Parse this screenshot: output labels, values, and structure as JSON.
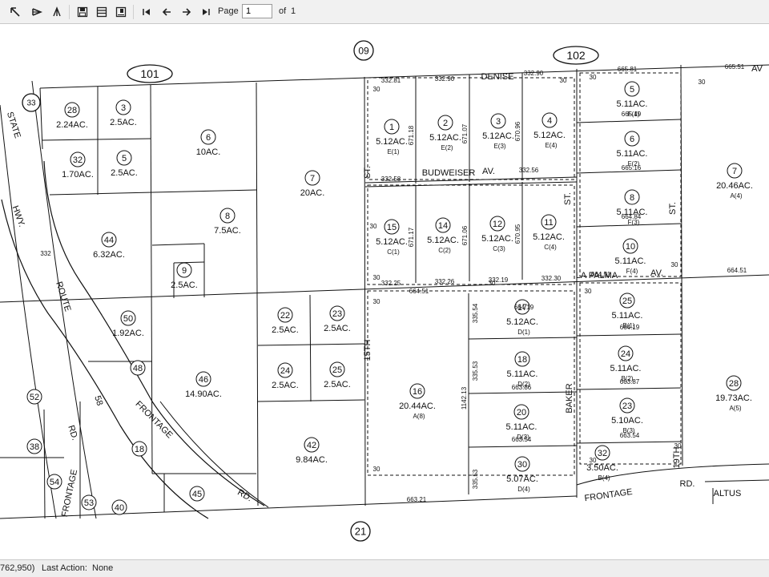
{
  "toolbar": {
    "page_label": "Page",
    "page_value": "1",
    "of_label": "of",
    "page_total": "1",
    "icons": [
      "print-icon",
      "export-icon",
      "tree-icon",
      "save-icon",
      "layout-icon",
      "save-as-icon",
      "first-page-icon",
      "prev-page-icon",
      "next-page-icon",
      "last-page-icon"
    ]
  },
  "map": {
    "road_circles": [
      "09",
      "101",
      "102",
      "21",
      "33"
    ],
    "roads": [
      {
        "text": "STATE"
      },
      {
        "text": "HWY."
      },
      {
        "text": "ROUTE"
      },
      {
        "text": "58"
      },
      {
        "text": "FRONTAGE"
      },
      {
        "text": "RD."
      },
      {
        "text": "FRONTAGE"
      },
      {
        "text": "RD."
      },
      {
        "text": "FRONTAGE"
      },
      {
        "text": "RD."
      },
      {
        "text": "DENISE"
      },
      {
        "text": "BUDWEISER"
      },
      {
        "text": "AV."
      },
      {
        "text": "15TH"
      },
      {
        "text": "ST."
      },
      {
        "text": "LA PALMA"
      },
      {
        "text": "AV."
      },
      {
        "text": "BAKER"
      },
      {
        "text": "19TH"
      },
      {
        "text": "ST."
      },
      {
        "text": "ALTUS"
      },
      {
        "text": "AV"
      },
      {
        "text": "ST."
      }
    ],
    "parcels": [
      {
        "num": "28",
        "area": "2.24AC."
      },
      {
        "num": "3",
        "area": "2.5AC."
      },
      {
        "num": "32",
        "area": "1.70AC."
      },
      {
        "num": "5",
        "area": "2.5AC."
      },
      {
        "num": "6",
        "area": "10AC."
      },
      {
        "num": "7",
        "area": "20AC."
      },
      {
        "num": "44",
        "area": "6.32AC."
      },
      {
        "num": "8",
        "area": "7.5AC."
      },
      {
        "num": "9",
        "area": "2.5AC."
      },
      {
        "num": "50",
        "area": "1.92AC."
      },
      {
        "num": "48",
        "area": ""
      },
      {
        "num": "46",
        "area": "14.90AC."
      },
      {
        "num": "22",
        "area": "2.5AC."
      },
      {
        "num": "23",
        "area": "2.5AC."
      },
      {
        "num": "24",
        "area": "2.5AC."
      },
      {
        "num": "25",
        "area": "2.5AC."
      },
      {
        "num": "42",
        "area": "9.84AC."
      },
      {
        "num": "52",
        "area": ""
      },
      {
        "num": "38",
        "area": ""
      },
      {
        "num": "18",
        "area": ""
      },
      {
        "num": "54",
        "area": ""
      },
      {
        "num": "53",
        "area": ""
      },
      {
        "num": "40",
        "area": ""
      },
      {
        "num": "45",
        "area": ""
      },
      {
        "num": "1",
        "area": "5.12AC.",
        "sub": "E(1)"
      },
      {
        "num": "2",
        "area": "5.12AC.",
        "sub": "E(2)"
      },
      {
        "num": "3",
        "area": "5.12AC.",
        "sub": "E(3)"
      },
      {
        "num": "4",
        "area": "5.12AC.",
        "sub": "E(4)"
      },
      {
        "num": "15",
        "area": "5.12AC.",
        "sub": "C(1)"
      },
      {
        "num": "14",
        "area": "5.12AC.",
        "sub": "C(2)"
      },
      {
        "num": "12",
        "area": "5.12AC.",
        "sub": "C(3)"
      },
      {
        "num": "11",
        "area": "5.12AC.",
        "sub": "C(4)"
      },
      {
        "num": "5",
        "area": "5.11AC.",
        "sub": "F(1)"
      },
      {
        "num": "6",
        "area": "5.11AC.",
        "sub": "F(2)"
      },
      {
        "num": "8",
        "area": "5.11AC.",
        "sub": "F(3)"
      },
      {
        "num": "10",
        "area": "5.11AC.",
        "sub": "F(4)"
      },
      {
        "num": "7",
        "area": "20.46AC.",
        "sub": "A(4)"
      },
      {
        "num": "16",
        "area": "20.44AC.",
        "sub": "A(8)"
      },
      {
        "num": "17",
        "area": "5.12AC.",
        "sub": "D(1)"
      },
      {
        "num": "18",
        "area": "5.11AC.",
        "sub": "D(2)"
      },
      {
        "num": "20",
        "area": "5.11AC.",
        "sub": "D(3)"
      },
      {
        "num": "30",
        "area": "5.07AC.",
        "sub": "D(4)"
      },
      {
        "num": "25",
        "area": "5.11AC.",
        "sub": "B(1)"
      },
      {
        "num": "24",
        "area": "5.11AC.",
        "sub": "B(2)"
      },
      {
        "num": "23",
        "area": "5.10AC.",
        "sub": "B(3)"
      },
      {
        "num": "32",
        "area": "3.50AC.",
        "sub": "B(4)"
      },
      {
        "num": "28",
        "area": "19.73AC.",
        "sub": "A(5)"
      }
    ],
    "dims": [
      "665.81",
      "665.51",
      "665.49",
      "665.16",
      "664.84",
      "664.51",
      "664.51",
      "664.51",
      "664.19",
      "664.19",
      "663.87",
      "663.86",
      "663.54",
      "663.54",
      "663.21",
      "332.81",
      "332.90",
      "332.90",
      "332.58",
      "332.56",
      "332.25",
      "332.26",
      "332.19",
      "332.30",
      "671.18",
      "671.07",
      "670.96",
      "671.17",
      "671.06",
      "670.95",
      "1142.13",
      "335.54",
      "335.53",
      "335.53",
      "332",
      "30",
      "30",
      "30",
      "30",
      "30",
      "30",
      "30",
      "30",
      "30",
      "30",
      "30",
      "30",
      "30"
    ]
  },
  "status": {
    "coords": "762,950)",
    "last_action_label": "Last Action:",
    "last_action_value": "None"
  }
}
